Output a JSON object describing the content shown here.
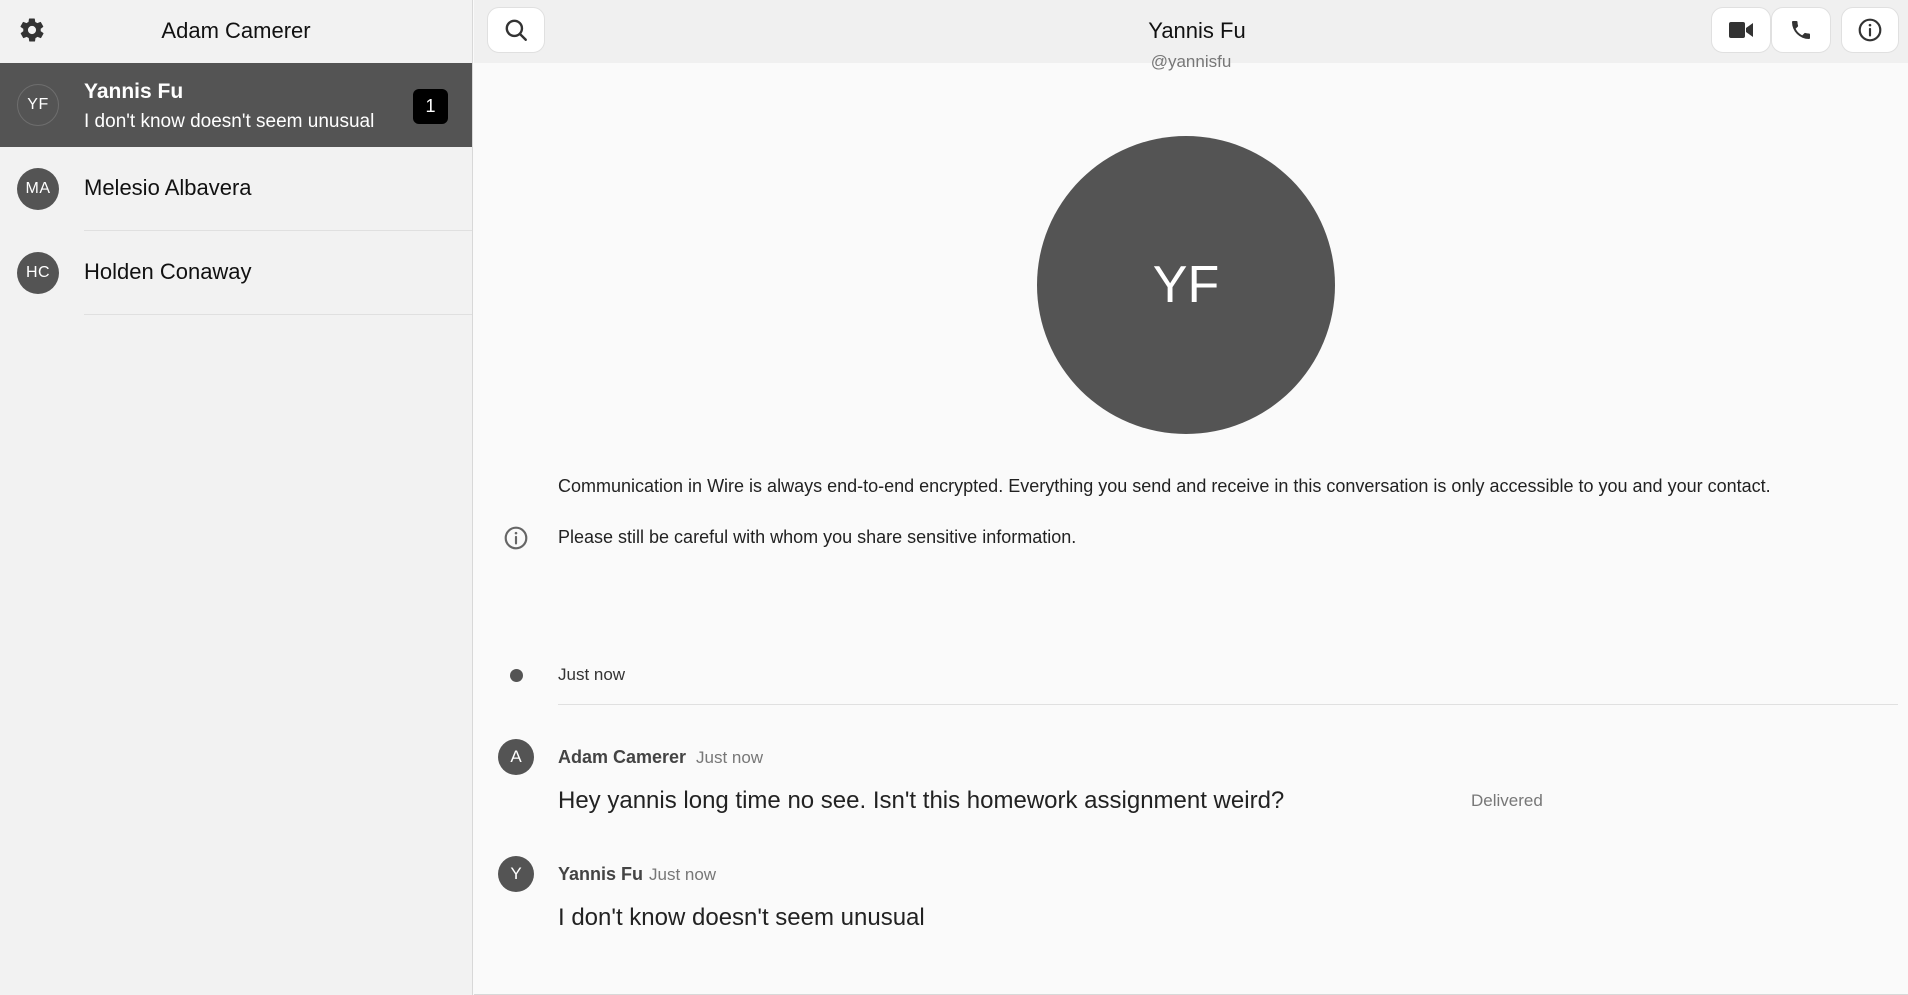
{
  "sidebar": {
    "user_name": "Adam Camerer",
    "conversations": [
      {
        "initials": "YF",
        "name": "Yannis Fu",
        "preview": "I don't know doesn't seem unusual",
        "unread": "1"
      },
      {
        "initials": "MA",
        "name": "Melesio Albavera"
      },
      {
        "initials": "HC",
        "name": "Holden Conaway"
      }
    ]
  },
  "conversation": {
    "title": "Yannis Fu",
    "handle": "@yannisfu",
    "avatar_initials": "YF",
    "encryption_notice_line1": "Communication in Wire is always end-to-end encrypted. Everything you send and receive in this conversation is only accessible to you and your contact.",
    "encryption_notice_line2": "Please still be careful with whom you share sensitive information.",
    "timeline_label": "Just now",
    "messages": [
      {
        "avatar": "A",
        "sender": "Adam Camerer",
        "time": "Just now",
        "text": "Hey yannis long time no see. Isn't this homework assignment weird?",
        "status": "Delivered"
      },
      {
        "avatar": "Y",
        "sender": "Yannis Fu",
        "time": "Just now",
        "text": "I don't know doesn't seem unusual"
      }
    ]
  },
  "icons": {
    "settings": "gear-icon",
    "search": "search-icon",
    "video": "video-camera-icon",
    "call": "phone-icon",
    "info": "info-icon"
  },
  "colors": {
    "active_row": "#545454",
    "avatar": "#545454",
    "badge": "#000000",
    "sidebar_bg": "#f2f2f2",
    "main_bg": "#fafafa"
  }
}
